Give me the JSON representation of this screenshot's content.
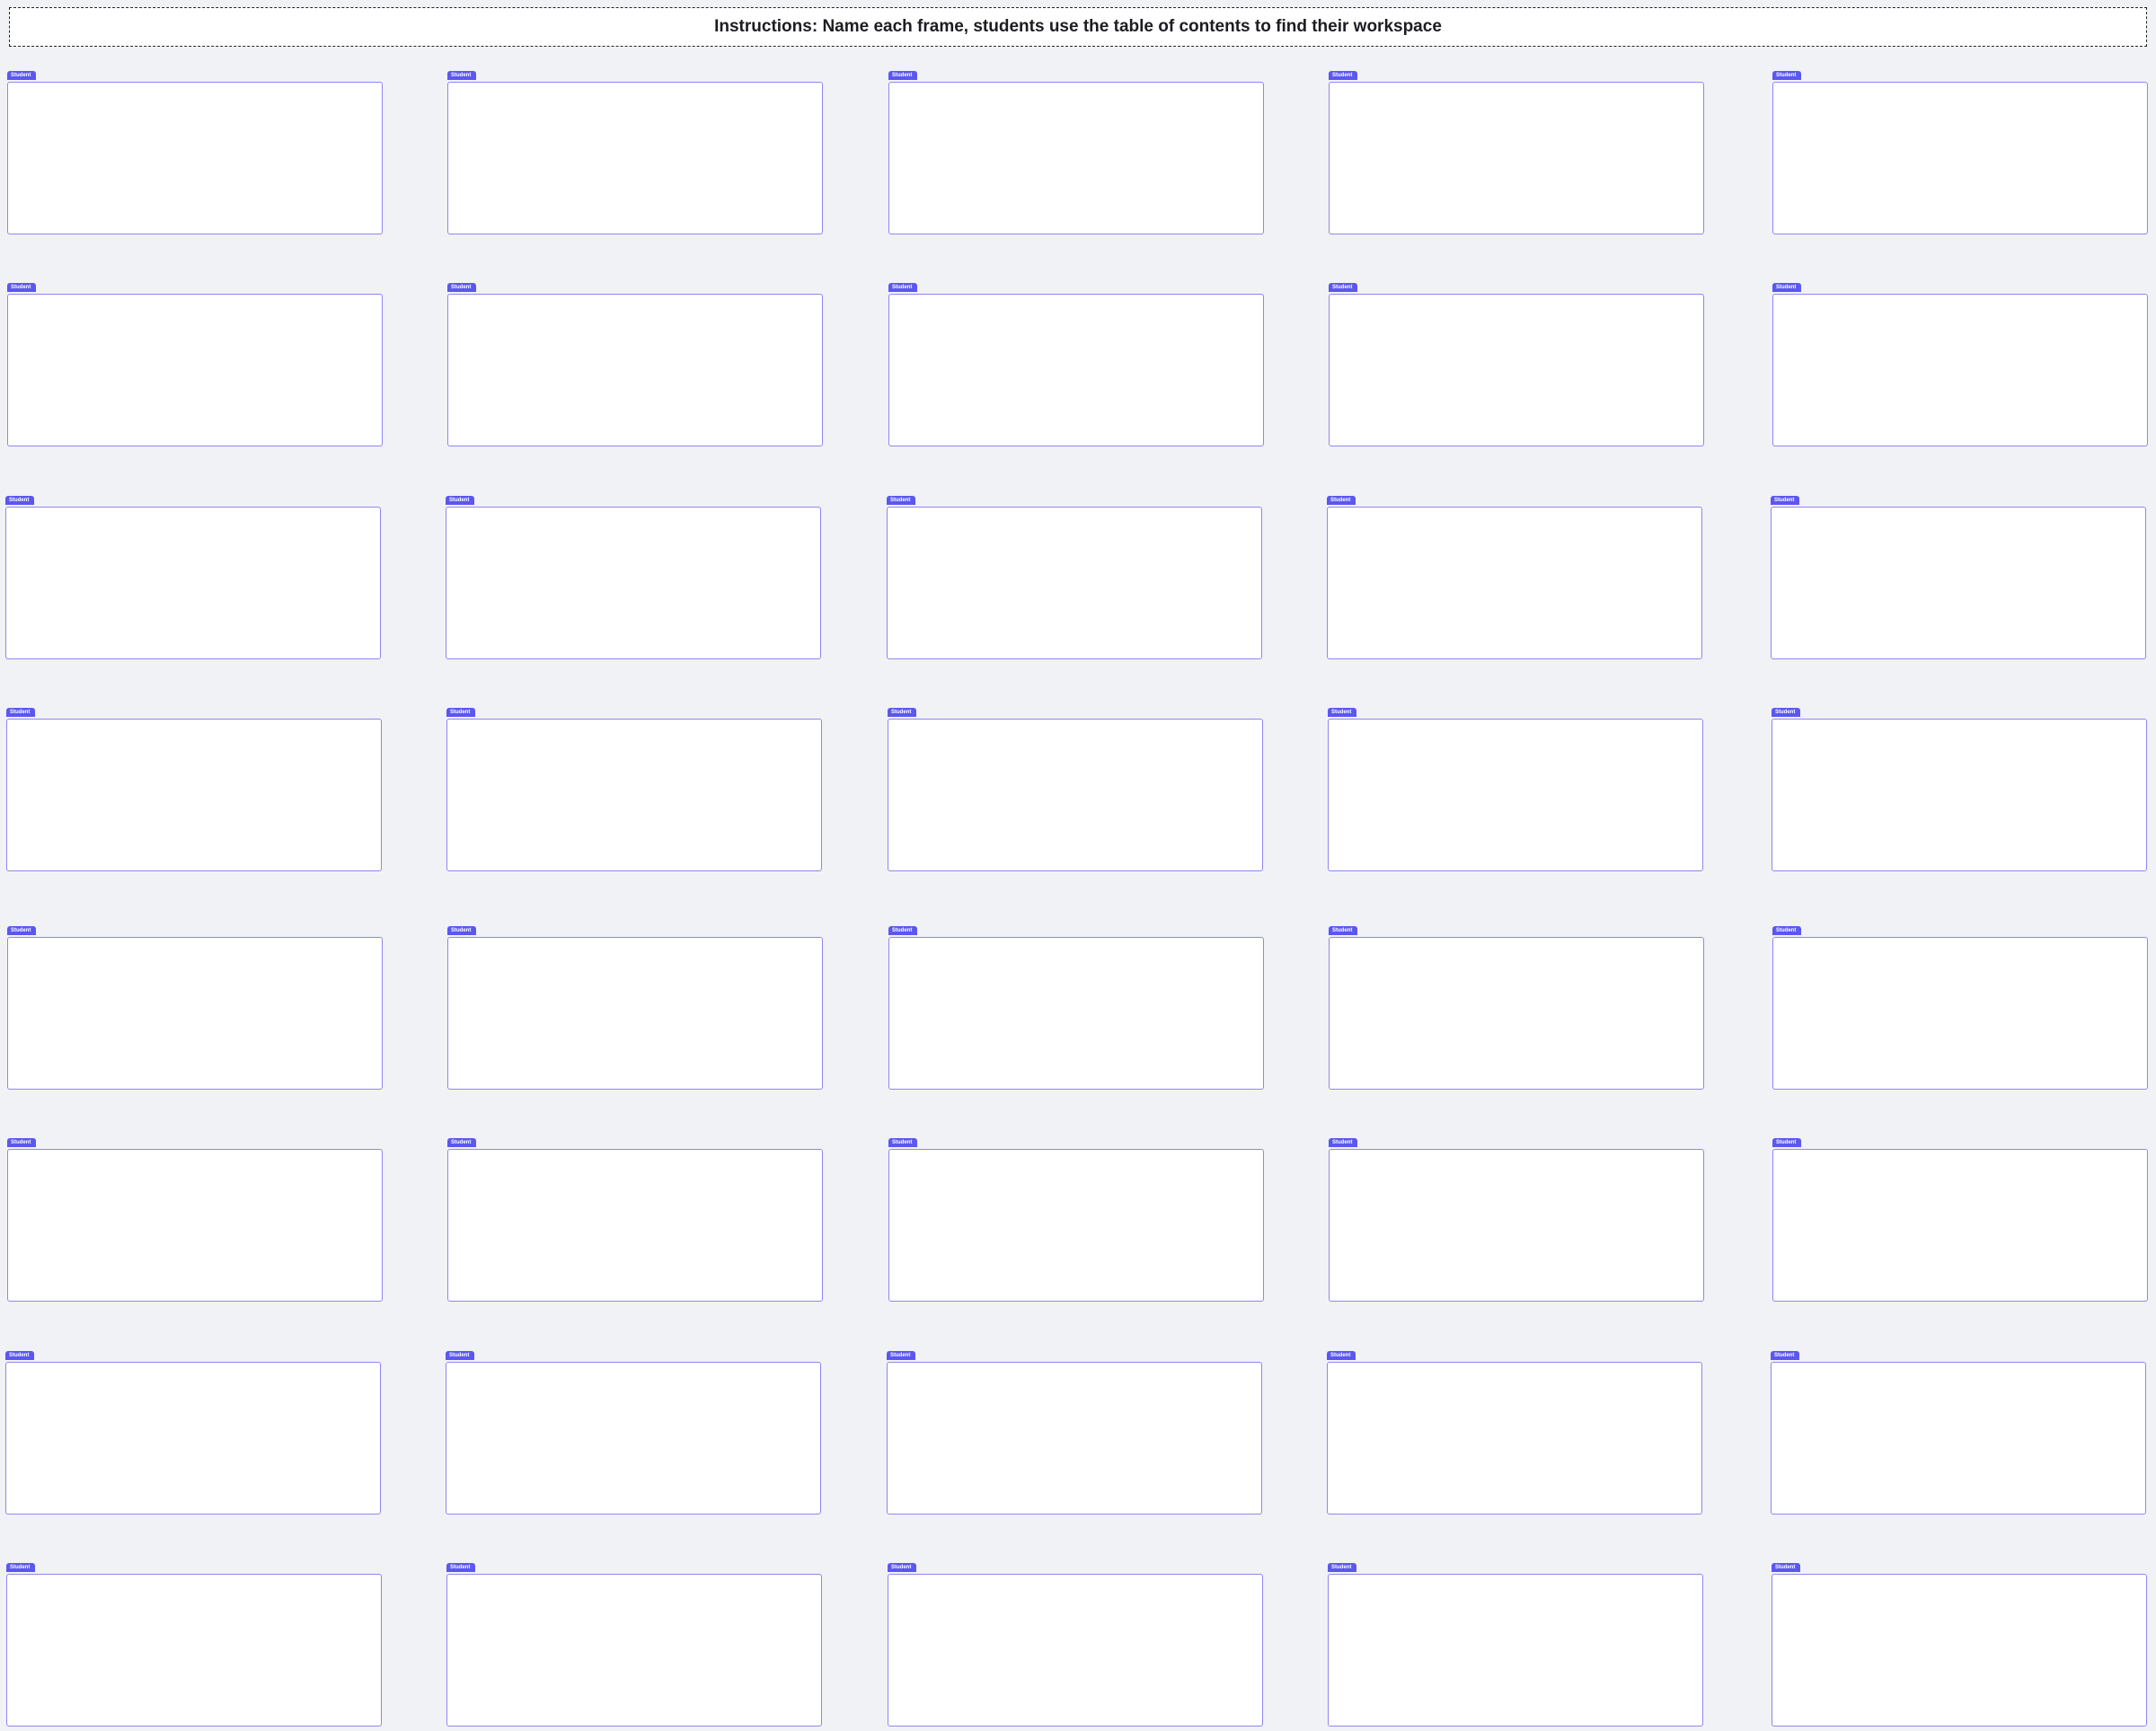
{
  "instructions": {
    "text": "Instructions: Name each frame, students use the table of contents to find their workspace"
  },
  "colors": {
    "canvas_background": "#f1f2f5",
    "frame_background": "#ffffff",
    "frame_border": "#8e86f2",
    "frame_tag_background": "#5b57f0",
    "frame_tag_text": "#ffffff",
    "instructions_border": "#222222",
    "instructions_text": "#1c1c22"
  },
  "frames": {
    "tag_label": "Student",
    "rows": 8,
    "columns": 5,
    "count": 40
  }
}
